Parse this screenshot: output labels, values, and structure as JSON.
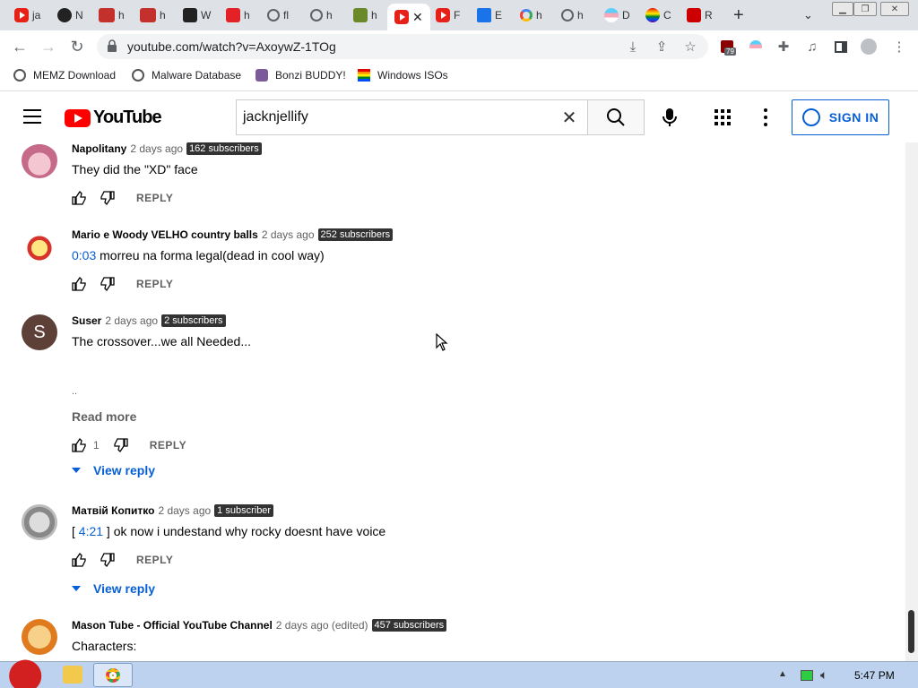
{
  "browser": {
    "tabs": [
      {
        "icon": "youtube-icon",
        "title": "ja"
      },
      {
        "icon": "github-icon",
        "title": "N"
      },
      {
        "icon": "youtube-old-icon",
        "title": "h"
      },
      {
        "icon": "youtube-old-icon",
        "title": "h"
      },
      {
        "icon": "wikipedia-icon",
        "title": "W"
      },
      {
        "icon": "adobe-icon",
        "title": "h"
      },
      {
        "icon": "globe-icon",
        "title": "fl"
      },
      {
        "icon": "globe-icon",
        "title": "h"
      },
      {
        "icon": "bird-icon",
        "title": "h"
      },
      {
        "icon": "youtube-icon",
        "title": "",
        "active": true
      },
      {
        "icon": "youtube-icon",
        "title": "F"
      },
      {
        "icon": "puzzle-icon",
        "title": "E"
      },
      {
        "icon": "google-icon",
        "title": "h"
      },
      {
        "icon": "globe-icon",
        "title": "h"
      },
      {
        "icon": "trans-flag-icon",
        "title": "D"
      },
      {
        "icon": "rainbow-icon",
        "title": "C"
      },
      {
        "icon": "dislike-icon",
        "title": "R"
      }
    ],
    "url": "youtube.com/watch?v=AxoywZ-1TOg",
    "extension_badge": "79",
    "bookmarks": [
      {
        "icon": "memz-icon",
        "label": "MEMZ Download"
      },
      {
        "icon": "globe-icon",
        "label": "Malware Database"
      },
      {
        "icon": "bonzi-icon",
        "label": "Bonzi BUDDY!"
      },
      {
        "icon": "windows-icon",
        "label": "Windows ISOs"
      }
    ]
  },
  "youtube": {
    "logo": "YouTube",
    "search_value": "jacknjellify",
    "sign_in": "SIGN IN"
  },
  "comments": [
    {
      "author": "Napolitany",
      "time": "2 days ago",
      "subs": "162 subscribers",
      "text": "They did the \"XD\" face",
      "likes": "",
      "reply": "REPLY"
    },
    {
      "author": "Mario e Woody VELHO country balls",
      "time": "2 days ago",
      "subs": "252 subscribers",
      "timestamp": "0:03",
      "text": " morreu na forma legal(dead in cool way)",
      "likes": "",
      "reply": "REPLY"
    },
    {
      "author": "Suser",
      "time": "2 days ago",
      "subs": "2 subscribers",
      "avatar_letter": "S",
      "text": "The crossover...we all Needed...",
      "ellipsis": "..",
      "read_more": "Read more",
      "likes": "1",
      "reply": "REPLY",
      "view_reply": "View reply"
    },
    {
      "author": "Матвій Копитко",
      "time": "2 days ago",
      "subs": "1 subscriber",
      "text_prefix": "[ ",
      "timestamp": "4:21",
      "text": " ] ok now i undestand why rocky doesnt have voice",
      "likes": "",
      "reply": "REPLY",
      "view_reply": "View reply"
    },
    {
      "author": "Mason Tube - Official YouTube Channel",
      "time": "2 days ago (edited)",
      "subs": "457 subscribers",
      "text": "Characters:"
    }
  ],
  "taskbar": {
    "time": "5:47 PM"
  },
  "colors": {
    "accent_blue": "#065fd4",
    "youtube_red": "#ff0000",
    "badge_dark": "#333333"
  }
}
